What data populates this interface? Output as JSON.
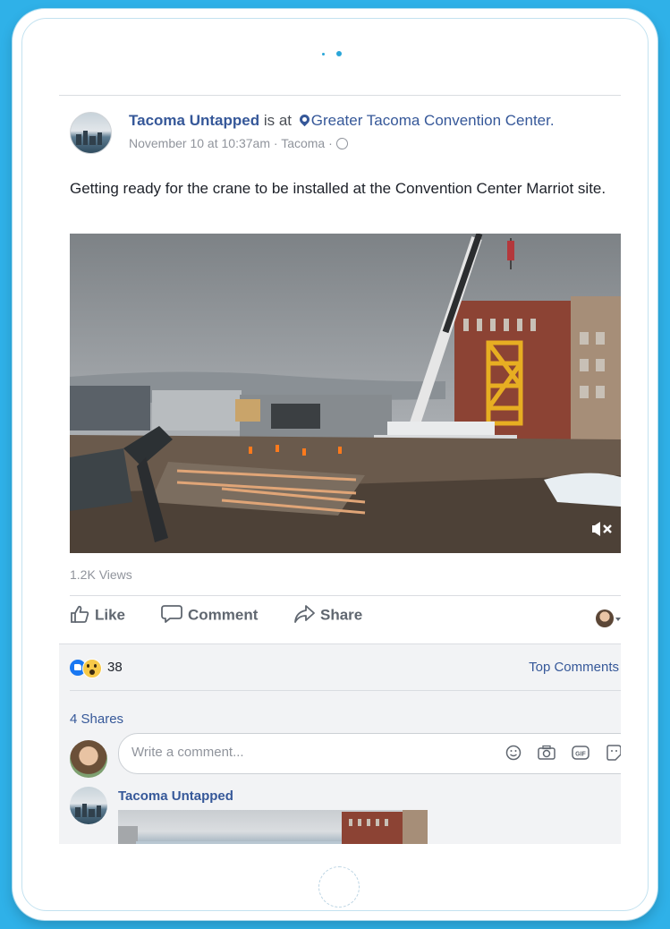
{
  "post": {
    "page_name": "Tacoma Untapped",
    "connector": "is at",
    "location": "Greater Tacoma Convention Center.",
    "timestamp": "November 10 at 10:37am",
    "city": "Tacoma",
    "text": "Getting ready for the crane to be installed at the Convention Center Marriot site.",
    "views": "1.2K Views"
  },
  "actions": {
    "like_label": "Like",
    "comment_label": "Comment",
    "share_label": "Share"
  },
  "reactions": {
    "count": "38",
    "top_comments_label": "Top Comments",
    "shares_label": "4 Shares"
  },
  "comment_box": {
    "placeholder": "Write a comment..."
  },
  "comment": {
    "author": "Tacoma Untapped"
  },
  "icons": {
    "video_mute": "volume-mute-icon",
    "emoji": "smiley-icon",
    "camera": "camera-icon",
    "gif": "gif-icon",
    "sticker": "sticker-icon",
    "location": "map-pin-icon",
    "audience": "globe-icon"
  },
  "colors": {
    "background": "#2fb1e8",
    "link": "#365899",
    "like_blue": "#1877f2"
  }
}
